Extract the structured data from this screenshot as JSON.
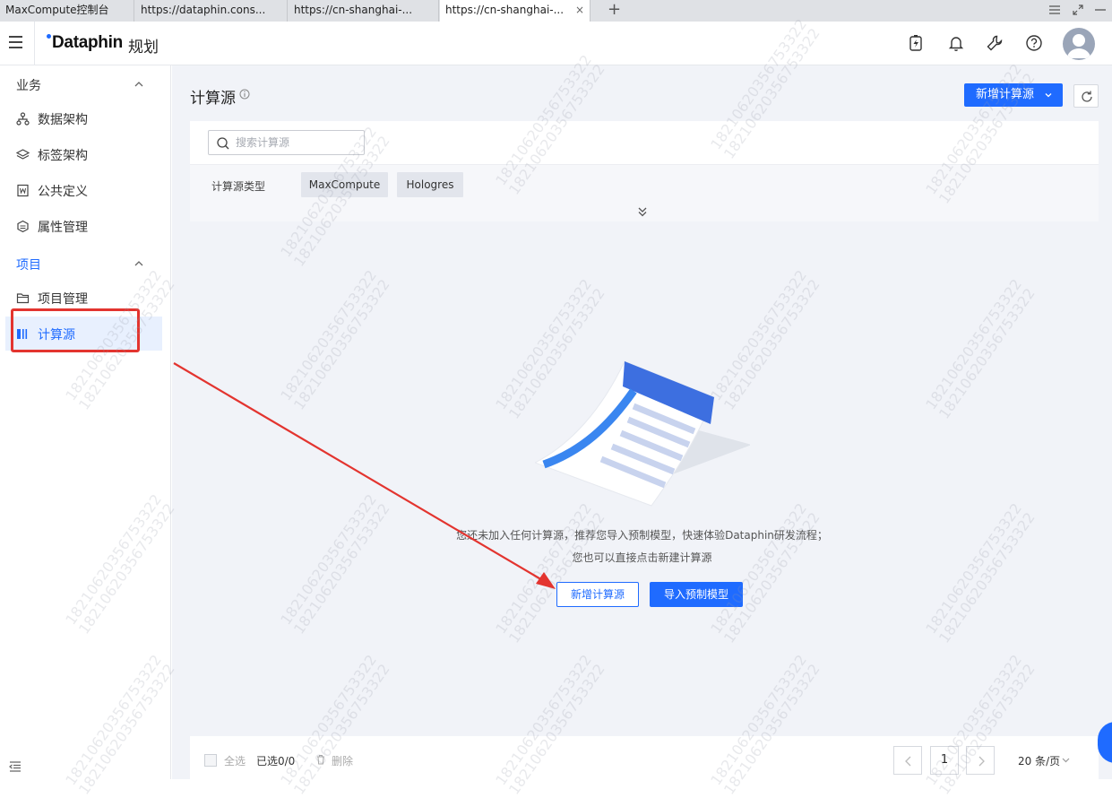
{
  "browser": {
    "tabs": [
      {
        "label": "MaxCompute控制台"
      },
      {
        "label": "https://dataphin.cons..."
      },
      {
        "label": "https://cn-shanghai-..."
      },
      {
        "label": "https://cn-shanghai-..."
      }
    ],
    "active_tab": 3,
    "new_tab_glyph": "+",
    "close_glyph": "×"
  },
  "header": {
    "logo": "Dataphin",
    "module": "规划",
    "icons": [
      "lightning-battery-icon",
      "bell-icon",
      "wrench-icon",
      "help-icon",
      "avatar"
    ]
  },
  "sidebar": {
    "group_business": "业务",
    "items_business": [
      {
        "label": "数据架构",
        "icon": "hierarchy-icon"
      },
      {
        "label": "标签架构",
        "icon": "layers-icon"
      },
      {
        "label": "公共定义",
        "icon": "word-doc-icon"
      },
      {
        "label": "属性管理",
        "icon": "hexagon-icon"
      }
    ],
    "group_project": "项目",
    "items_project": [
      {
        "label": "项目管理",
        "icon": "folder-icon"
      },
      {
        "label": "计算源",
        "icon": "compute-source-icon",
        "active": true
      }
    ]
  },
  "main": {
    "title": "计算源",
    "new_button": "新增计算源",
    "search_placeholder": "搜索计算源",
    "type_label": "计算源类型",
    "type_chips": [
      "MaxCompute",
      "Hologres"
    ],
    "empty_line1": "您还未加入任何计算源，推荐您导入预制模型，快速体验Dataphin研发流程；",
    "empty_line2": "您也可以直接点击新建计算源",
    "empty_btn_new": "新增计算源",
    "empty_btn_import": "导入预制模型"
  },
  "footer": {
    "select_all": "全选",
    "selected": "已选0/0",
    "delete": "删除",
    "page": "1",
    "page_size": "20 条/页"
  },
  "watermark": {
    "line1": "18210620356753322",
    "line2": "18210620356753322"
  },
  "colors": {
    "primary": "#1f6bff",
    "highlight": "#e3342f",
    "bg": "#f1f3f8"
  }
}
